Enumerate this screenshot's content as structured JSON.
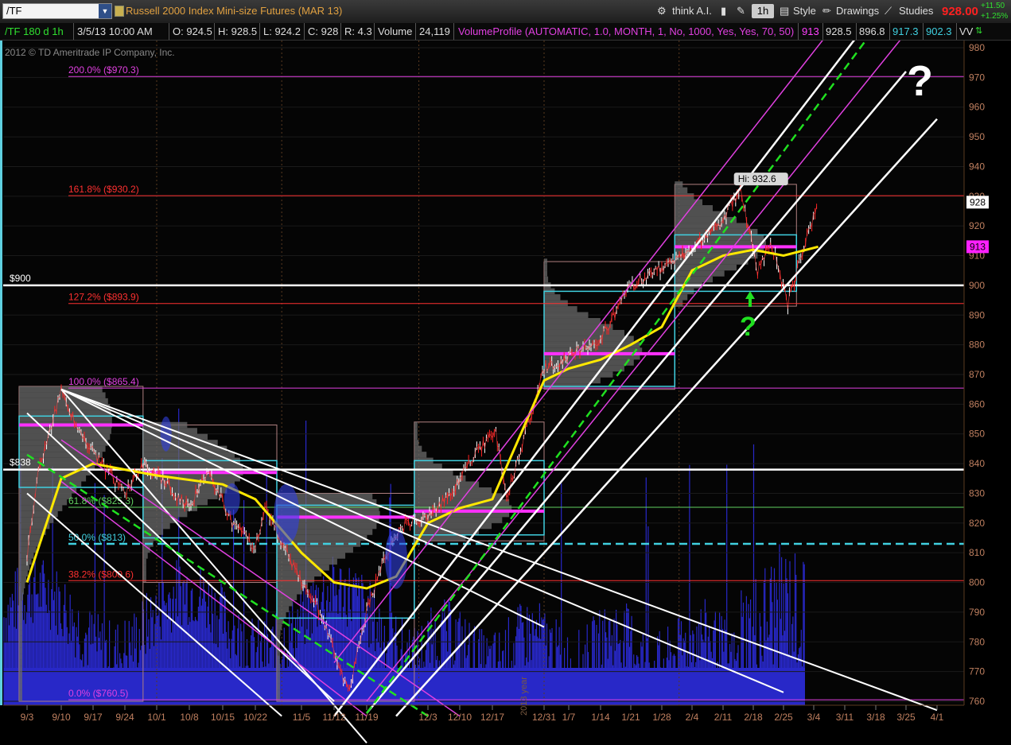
{
  "toolbar": {
    "symbol": "/TF",
    "description": "Russell 2000 Index Mini-size Futures (MAR 13)",
    "think_ai": "think A.I.",
    "interval": "1h",
    "style": "Style",
    "drawings": "Drawings",
    "studies": "Studies",
    "last_price": "928.00",
    "net_change": "+11.50",
    "pct_change": "+1.25%"
  },
  "infobar": {
    "symbol": "/TF 180 d 1h",
    "datetime": "3/5/13 10:00 AM",
    "open": "O: 924.5",
    "high": "H: 928.5",
    "low": "L: 924.2",
    "close": "C: 928",
    "range": "R: 4.3",
    "volume_label": "Volume",
    "volume": "24,119",
    "study": "VolumeProfile (AUTOMATIC, 1.0, MONTH, 1, No, 1000, Yes, Yes, 70, 50)",
    "vp1": "913",
    "vp2": "928.5",
    "vp3": "896.8",
    "vp4": "917.3",
    "vp5": "902.3",
    "trail": "VV"
  },
  "copyright": "2012 © TD Ameritrade IP Company, Inc.",
  "colors": {
    "fib": "#e040e0",
    "fib_red": "#ff3030",
    "fib_green": "#60d060",
    "fib_cyan": "#40d0e0",
    "price_axis": "#c08060",
    "volume": "#2828c8",
    "ma": "#ffe800",
    "channel": "#ffffff",
    "midline": "#20e020"
  },
  "chart_data": {
    "type": "line",
    "instrument": "/TF 1h",
    "ylim": [
      755,
      982
    ],
    "y_ticks": [
      760,
      770,
      780,
      790,
      800,
      810,
      820,
      830,
      840,
      850,
      860,
      870,
      880,
      890,
      900,
      910,
      920,
      930,
      940,
      950,
      960,
      970,
      980
    ],
    "x_ticks": [
      "9/3",
      "9/10",
      "9/17",
      "9/24",
      "10/1",
      "10/8",
      "10/15",
      "10/22",
      "11/5",
      "11/12",
      "11/19",
      "12/3",
      "12/10",
      "12/17",
      "12/31",
      "1/7",
      "1/14",
      "1/21",
      "1/28",
      "2/4",
      "2/11",
      "2/18",
      "2/25",
      "3/4",
      "3/11",
      "3/18",
      "3/25",
      "4/1"
    ],
    "year_label": "2013 year",
    "fib_levels": [
      {
        "label": "200.0%",
        "price": "($970.3)",
        "value": 970.3,
        "color": "#e040e0"
      },
      {
        "label": "161.8%",
        "price": "($930.2)",
        "value": 930.2,
        "color": "#ff3030"
      },
      {
        "label": "127.2%",
        "price": "($893.9)",
        "value": 893.9,
        "color": "#ff3030"
      },
      {
        "label": "100.0%",
        "price": "($865.4)",
        "value": 865.4,
        "color": "#e040e0"
      },
      {
        "label": "61.8%",
        "price": "($825.3)",
        "value": 825.3,
        "color": "#60d060"
      },
      {
        "label": "50.0%",
        "price": "($813)",
        "value": 813,
        "color": "#40d0e0"
      },
      {
        "label": "38.2%",
        "price": "($800.6)",
        "value": 800.6,
        "color": "#ff3030"
      },
      {
        "label": "0.0%",
        "price": "($760.5)",
        "value": 760.5,
        "color": "#e040e0"
      }
    ],
    "horizontal_lines": [
      {
        "label": "$900",
        "value": 900
      },
      {
        "label": "$838",
        "value": 838
      }
    ],
    "axis_markers": [
      {
        "label": "928",
        "value": 928,
        "bg": "#ffffff",
        "fg": "#000000"
      },
      {
        "label": "913",
        "value": 913,
        "bg": "#ff20ff",
        "fg": "#000000"
      }
    ],
    "high_bubble": "Hi: 932.6",
    "question_marks": [
      {
        "text": "?",
        "color": "#ffffff"
      },
      {
        "text": "?",
        "color": "#20e020"
      }
    ],
    "price_path": [
      {
        "x": "9/3",
        "y": 808
      },
      {
        "x": "9/5",
        "y": 835
      },
      {
        "x": "9/10",
        "y": 865
      },
      {
        "x": "9/14",
        "y": 850
      },
      {
        "x": "9/19",
        "y": 840
      },
      {
        "x": "9/24",
        "y": 830
      },
      {
        "x": "9/28",
        "y": 840
      },
      {
        "x": "10/2",
        "y": 835
      },
      {
        "x": "10/8",
        "y": 825
      },
      {
        "x": "10/12",
        "y": 838
      },
      {
        "x": "10/17",
        "y": 820
      },
      {
        "x": "10/22",
        "y": 812
      },
      {
        "x": "10/26",
        "y": 825
      },
      {
        "x": "11/5",
        "y": 800
      },
      {
        "x": "11/9",
        "y": 790
      },
      {
        "x": "11/15",
        "y": 763
      },
      {
        "x": "11/19",
        "y": 790
      },
      {
        "x": "11/23",
        "y": 808
      },
      {
        "x": "11/28",
        "y": 820
      },
      {
        "x": "12/3",
        "y": 822
      },
      {
        "x": "12/8",
        "y": 830
      },
      {
        "x": "12/14",
        "y": 845
      },
      {
        "x": "12/18",
        "y": 850
      },
      {
        "x": "12/21",
        "y": 828
      },
      {
        "x": "12/31",
        "y": 872
      },
      {
        "x": "1/7",
        "y": 876
      },
      {
        "x": "1/14",
        "y": 882
      },
      {
        "x": "1/21",
        "y": 900
      },
      {
        "x": "1/28",
        "y": 906
      },
      {
        "x": "2/4",
        "y": 912
      },
      {
        "x": "2/11",
        "y": 922
      },
      {
        "x": "2/15",
        "y": 932.6
      },
      {
        "x": "2/19",
        "y": 905
      },
      {
        "x": "2/22",
        "y": 915
      },
      {
        "x": "2/26",
        "y": 894
      },
      {
        "x": "3/1",
        "y": 910
      },
      {
        "x": "3/5",
        "y": 928
      }
    ],
    "moving_average": [
      {
        "x": "9/3",
        "y": 800
      },
      {
        "x": "9/10",
        "y": 835
      },
      {
        "x": "9/17",
        "y": 840
      },
      {
        "x": "9/24",
        "y": 838
      },
      {
        "x": "10/1",
        "y": 836
      },
      {
        "x": "10/15",
        "y": 833
      },
      {
        "x": "10/22",
        "y": 828
      },
      {
        "x": "11/5",
        "y": 810
      },
      {
        "x": "11/12",
        "y": 800
      },
      {
        "x": "11/19",
        "y": 798
      },
      {
        "x": "11/26",
        "y": 802
      },
      {
        "x": "12/3",
        "y": 820
      },
      {
        "x": "12/10",
        "y": 825
      },
      {
        "x": "12/17",
        "y": 828
      },
      {
        "x": "12/31",
        "y": 868
      },
      {
        "x": "1/7",
        "y": 872
      },
      {
        "x": "1/14",
        "y": 875
      },
      {
        "x": "1/21",
        "y": 880
      },
      {
        "x": "1/28",
        "y": 886
      },
      {
        "x": "2/4",
        "y": 905
      },
      {
        "x": "2/11",
        "y": 910
      },
      {
        "x": "2/18",
        "y": 912
      },
      {
        "x": "2/25",
        "y": 910
      },
      {
        "x": "3/5",
        "y": 913
      }
    ],
    "volume_profile_pocs": [
      {
        "from": "9/1",
        "to": "9/28",
        "value": 853
      },
      {
        "from": "9/28",
        "to": "10/31",
        "value": 837
      },
      {
        "from": "10/31",
        "to": "11/30",
        "value": 822
      },
      {
        "from": "11/30",
        "to": "12/31",
        "value": 824
      },
      {
        "from": "12/31",
        "to": "1/31",
        "value": 877
      },
      {
        "from": "1/31",
        "to": "2/28",
        "value": 913
      }
    ]
  }
}
